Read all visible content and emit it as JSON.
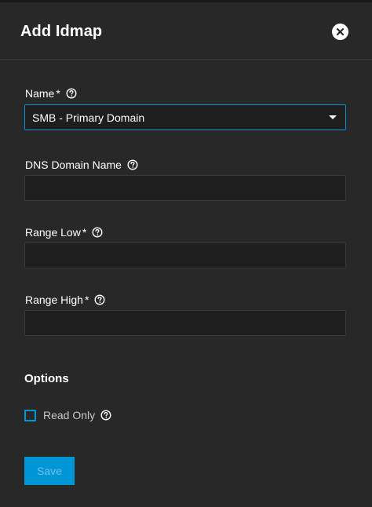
{
  "dialog": {
    "title": "Add Idmap"
  },
  "form": {
    "name": {
      "label": "Name",
      "required_marker": "*",
      "value": "SMB - Primary Domain"
    },
    "dns_domain_name": {
      "label": "DNS Domain Name",
      "value": ""
    },
    "range_low": {
      "label": "Range Low",
      "required_marker": "*",
      "value": ""
    },
    "range_high": {
      "label": "Range High",
      "required_marker": "*",
      "value": ""
    }
  },
  "options": {
    "title": "Options",
    "read_only": {
      "label": "Read Only",
      "checked": false
    }
  },
  "actions": {
    "save_label": "Save",
    "save_disabled": true
  },
  "icons": {
    "close": "close-icon",
    "help": "help-icon",
    "dropdown": "chevron-down-icon"
  },
  "colors": {
    "background": "#282828",
    "input_background": "#1e1e1e",
    "accent": "#0095d5"
  }
}
